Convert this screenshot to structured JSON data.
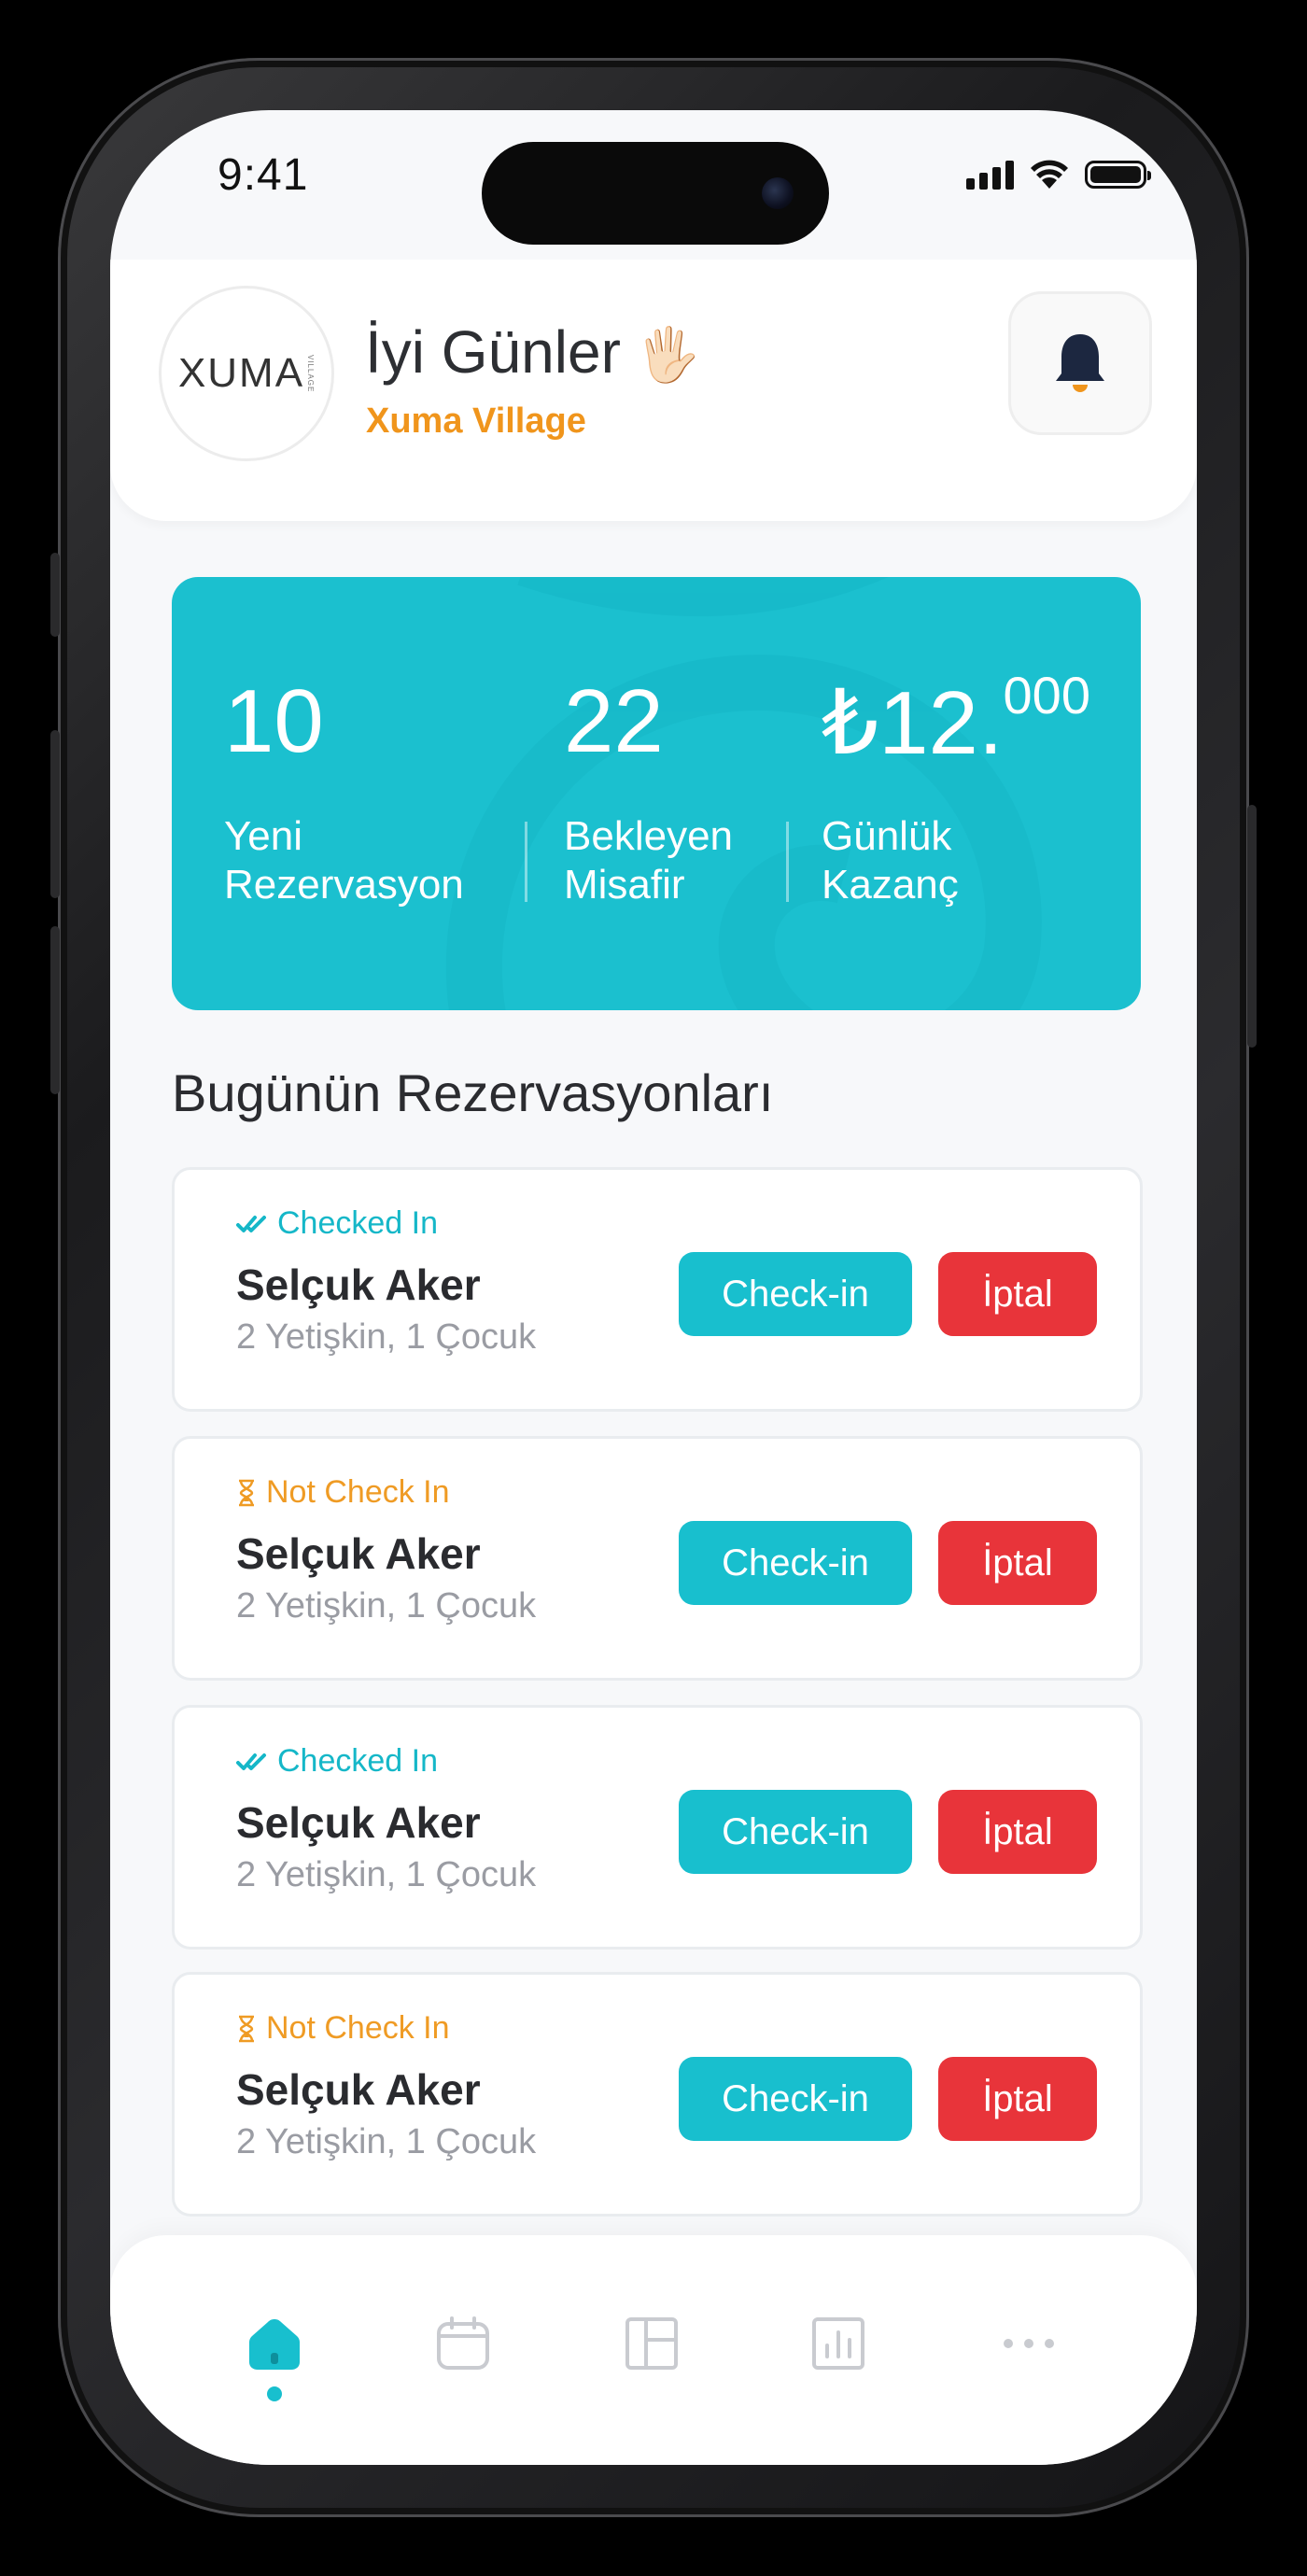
{
  "status_bar": {
    "time": "9:41"
  },
  "header": {
    "logo_text": "XUMA",
    "logo_subtext": "VILLAGE",
    "greeting": "İyi Günler",
    "greeting_emoji": "🖐🏻",
    "business_name": "Xuma Village"
  },
  "stats": [
    {
      "value": "10",
      "value_sup": "",
      "label_line1": "Yeni",
      "label_line2": "Rezervasyon"
    },
    {
      "value": "22",
      "value_sup": "",
      "label_line1": "Bekleyen",
      "label_line2": "Misafir"
    },
    {
      "value": "₺12.",
      "value_sup": "000",
      "label_line1": "Günlük",
      "label_line2": "Kazanç"
    }
  ],
  "section_title": "Bugünün Rezervasyonları",
  "reservations": [
    {
      "status": "Checked In",
      "status_icon": "double-check-icon",
      "name": "Selçuk Aker",
      "guests": "2 Yetişkin, 1 Çocuk",
      "checkin_label": "Check-in",
      "cancel_label": "İptal"
    },
    {
      "status": "Not Check In",
      "status_icon": "hourglass-icon",
      "name": "Selçuk Aker",
      "guests": "2 Yetişkin, 1 Çocuk",
      "checkin_label": "Check-in",
      "cancel_label": "İptal"
    },
    {
      "status": "Checked In",
      "status_icon": "double-check-icon",
      "name": "Selçuk Aker",
      "guests": "2 Yetişkin, 1 Çocuk",
      "checkin_label": "Check-in",
      "cancel_label": "İptal"
    },
    {
      "status": "Not Check In",
      "status_icon": "hourglass-icon",
      "name": "Selçuk Aker",
      "guests": "2 Yetişkin, 1 Çocuk",
      "checkin_label": "Check-in",
      "cancel_label": "İptal"
    }
  ],
  "bottom_nav": [
    {
      "icon": "home-icon",
      "active": true
    },
    {
      "icon": "calendar-icon",
      "active": false
    },
    {
      "icon": "layout-icon",
      "active": false
    },
    {
      "icon": "chart-icon",
      "active": false
    },
    {
      "icon": "more-icon",
      "active": false
    }
  ],
  "colors": {
    "accent": "#18bfce",
    "orange": "#f0951c",
    "danger": "#e8343a",
    "text": "#2b2c30",
    "muted": "#9a9ca3"
  }
}
